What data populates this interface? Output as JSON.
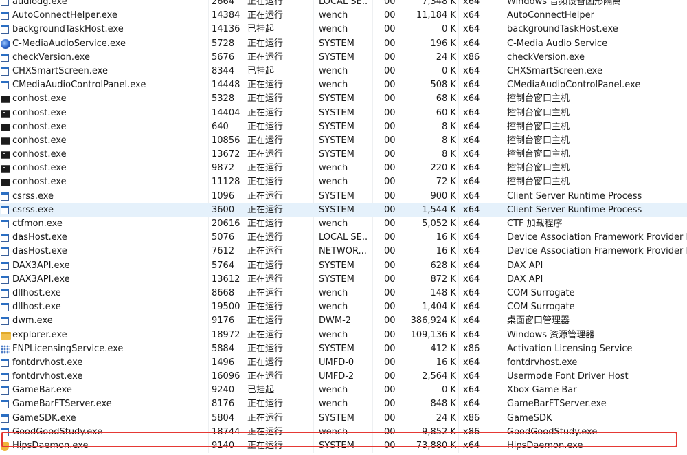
{
  "processes": [
    {
      "icon": "window",
      "name": "audiodg.exe",
      "pid": "2664",
      "status": "正在运行",
      "user": "LOCAL SE...",
      "session": "00",
      "memory": "7,348 K",
      "arch": "x64",
      "description": "Windows 音频设备图形隔离"
    },
    {
      "icon": "window",
      "name": "AutoConnectHelper.exe",
      "pid": "14384",
      "status": "正在运行",
      "user": "wench",
      "session": "00",
      "memory": "11,184 K",
      "arch": "x64",
      "description": "AutoConnectHelper"
    },
    {
      "icon": "window",
      "name": "backgroundTaskHost.exe",
      "pid": "14136",
      "status": "已挂起",
      "user": "wench",
      "session": "00",
      "memory": "0 K",
      "arch": "x64",
      "description": "backgroundTaskHost.exe"
    },
    {
      "icon": "media",
      "name": "C-MediaAudioService.exe",
      "pid": "5728",
      "status": "正在运行",
      "user": "SYSTEM",
      "session": "00",
      "memory": "196 K",
      "arch": "x64",
      "description": "C-Media Audio Service"
    },
    {
      "icon": "window",
      "name": "checkVersion.exe",
      "pid": "5676",
      "status": "正在运行",
      "user": "SYSTEM",
      "session": "00",
      "memory": "24 K",
      "arch": "x86",
      "description": "checkVersion.exe"
    },
    {
      "icon": "window",
      "name": "CHXSmartScreen.exe",
      "pid": "8344",
      "status": "已挂起",
      "user": "wench",
      "session": "00",
      "memory": "0 K",
      "arch": "x64",
      "description": "CHXSmartScreen.exe"
    },
    {
      "icon": "window",
      "name": "CMediaAudioControlPanel.exe",
      "pid": "14448",
      "status": "正在运行",
      "user": "wench",
      "session": "00",
      "memory": "508 K",
      "arch": "x64",
      "description": "CMediaAudioControlPanel.exe"
    },
    {
      "icon": "console",
      "name": "conhost.exe",
      "pid": "5328",
      "status": "正在运行",
      "user": "SYSTEM",
      "session": "00",
      "memory": "68 K",
      "arch": "x64",
      "description": "控制台窗口主机"
    },
    {
      "icon": "console",
      "name": "conhost.exe",
      "pid": "14404",
      "status": "正在运行",
      "user": "SYSTEM",
      "session": "00",
      "memory": "60 K",
      "arch": "x64",
      "description": "控制台窗口主机"
    },
    {
      "icon": "console",
      "name": "conhost.exe",
      "pid": "640",
      "status": "正在运行",
      "user": "SYSTEM",
      "session": "00",
      "memory": "8 K",
      "arch": "x64",
      "description": "控制台窗口主机"
    },
    {
      "icon": "console",
      "name": "conhost.exe",
      "pid": "10856",
      "status": "正在运行",
      "user": "SYSTEM",
      "session": "00",
      "memory": "8 K",
      "arch": "x64",
      "description": "控制台窗口主机"
    },
    {
      "icon": "console",
      "name": "conhost.exe",
      "pid": "13672",
      "status": "正在运行",
      "user": "SYSTEM",
      "session": "00",
      "memory": "8 K",
      "arch": "x64",
      "description": "控制台窗口主机"
    },
    {
      "icon": "console",
      "name": "conhost.exe",
      "pid": "9872",
      "status": "正在运行",
      "user": "wench",
      "session": "00",
      "memory": "220 K",
      "arch": "x64",
      "description": "控制台窗口主机"
    },
    {
      "icon": "console",
      "name": "conhost.exe",
      "pid": "11128",
      "status": "正在运行",
      "user": "wench",
      "session": "00",
      "memory": "72 K",
      "arch": "x64",
      "description": "控制台窗口主机"
    },
    {
      "icon": "window",
      "name": "csrss.exe",
      "pid": "1096",
      "status": "正在运行",
      "user": "SYSTEM",
      "session": "00",
      "memory": "900 K",
      "arch": "x64",
      "description": "Client Server Runtime Process"
    },
    {
      "icon": "window",
      "name": "csrss.exe",
      "pid": "3600",
      "status": "正在运行",
      "user": "SYSTEM",
      "session": "00",
      "memory": "1,544 K",
      "arch": "x64",
      "description": "Client Server Runtime Process",
      "selected": true
    },
    {
      "icon": "window",
      "name": "ctfmon.exe",
      "pid": "20616",
      "status": "正在运行",
      "user": "wench",
      "session": "00",
      "memory": "5,052 K",
      "arch": "x64",
      "description": "CTF 加载程序"
    },
    {
      "icon": "window",
      "name": "dasHost.exe",
      "pid": "5076",
      "status": "正在运行",
      "user": "LOCAL SE...",
      "session": "00",
      "memory": "16 K",
      "arch": "x64",
      "description": "Device Association Framework Provider Ho"
    },
    {
      "icon": "window",
      "name": "dasHost.exe",
      "pid": "7612",
      "status": "正在运行",
      "user": "NETWOR...",
      "session": "00",
      "memory": "16 K",
      "arch": "x64",
      "description": "Device Association Framework Provider Ho"
    },
    {
      "icon": "window",
      "name": "DAX3API.exe",
      "pid": "5764",
      "status": "正在运行",
      "user": "SYSTEM",
      "session": "00",
      "memory": "628 K",
      "arch": "x64",
      "description": "DAX API"
    },
    {
      "icon": "window",
      "name": "DAX3API.exe",
      "pid": "13612",
      "status": "正在运行",
      "user": "SYSTEM",
      "session": "00",
      "memory": "872 K",
      "arch": "x64",
      "description": "DAX API"
    },
    {
      "icon": "window",
      "name": "dllhost.exe",
      "pid": "8668",
      "status": "正在运行",
      "user": "wench",
      "session": "00",
      "memory": "148 K",
      "arch": "x64",
      "description": "COM Surrogate"
    },
    {
      "icon": "window",
      "name": "dllhost.exe",
      "pid": "19500",
      "status": "正在运行",
      "user": "wench",
      "session": "00",
      "memory": "1,404 K",
      "arch": "x64",
      "description": "COM Surrogate"
    },
    {
      "icon": "window",
      "name": "dwm.exe",
      "pid": "9176",
      "status": "正在运行",
      "user": "DWM-2",
      "session": "00",
      "memory": "386,924 K",
      "arch": "x64",
      "description": "桌面窗口管理器"
    },
    {
      "icon": "folder",
      "name": "explorer.exe",
      "pid": "18972",
      "status": "正在运行",
      "user": "wench",
      "session": "00",
      "memory": "109,136 K",
      "arch": "x64",
      "description": "Windows 资源管理器"
    },
    {
      "icon": "grid",
      "name": "FNPLicensingService.exe",
      "pid": "5884",
      "status": "正在运行",
      "user": "SYSTEM",
      "session": "00",
      "memory": "412 K",
      "arch": "x86",
      "description": "Activation Licensing Service"
    },
    {
      "icon": "window",
      "name": "fontdrvhost.exe",
      "pid": "1496",
      "status": "正在运行",
      "user": "UMFD-0",
      "session": "00",
      "memory": "16 K",
      "arch": "x64",
      "description": "fontdrvhost.exe"
    },
    {
      "icon": "window",
      "name": "fontdrvhost.exe",
      "pid": "16096",
      "status": "正在运行",
      "user": "UMFD-2",
      "session": "00",
      "memory": "2,564 K",
      "arch": "x64",
      "description": "Usermode Font Driver Host"
    },
    {
      "icon": "window",
      "name": "GameBar.exe",
      "pid": "9240",
      "status": "已挂起",
      "user": "wench",
      "session": "00",
      "memory": "0 K",
      "arch": "x64",
      "description": "Xbox Game Bar"
    },
    {
      "icon": "window",
      "name": "GameBarFTServer.exe",
      "pid": "8176",
      "status": "正在运行",
      "user": "wench",
      "session": "00",
      "memory": "848 K",
      "arch": "x64",
      "description": "GameBarFTServer.exe"
    },
    {
      "icon": "window",
      "name": "GameSDK.exe",
      "pid": "5804",
      "status": "正在运行",
      "user": "SYSTEM",
      "session": "00",
      "memory": "24 K",
      "arch": "x86",
      "description": "GameSDK"
    },
    {
      "icon": "window",
      "name": "GoodGoodStudy.exe",
      "pid": "18744",
      "status": "正在运行",
      "user": "wench",
      "session": "00",
      "memory": "9,852 K",
      "arch": "x86",
      "description": "GoodGoodStudy.exe"
    },
    {
      "icon": "shield",
      "name": "HipsDaemon.exe",
      "pid": "9140",
      "status": "正在运行",
      "user": "SYSTEM",
      "session": "00",
      "memory": "73,880 K",
      "arch": "x64",
      "description": "HipsDaemon.exe"
    }
  ],
  "highlight_color": "#e53935",
  "selected_row_color": "#e5f1fb"
}
